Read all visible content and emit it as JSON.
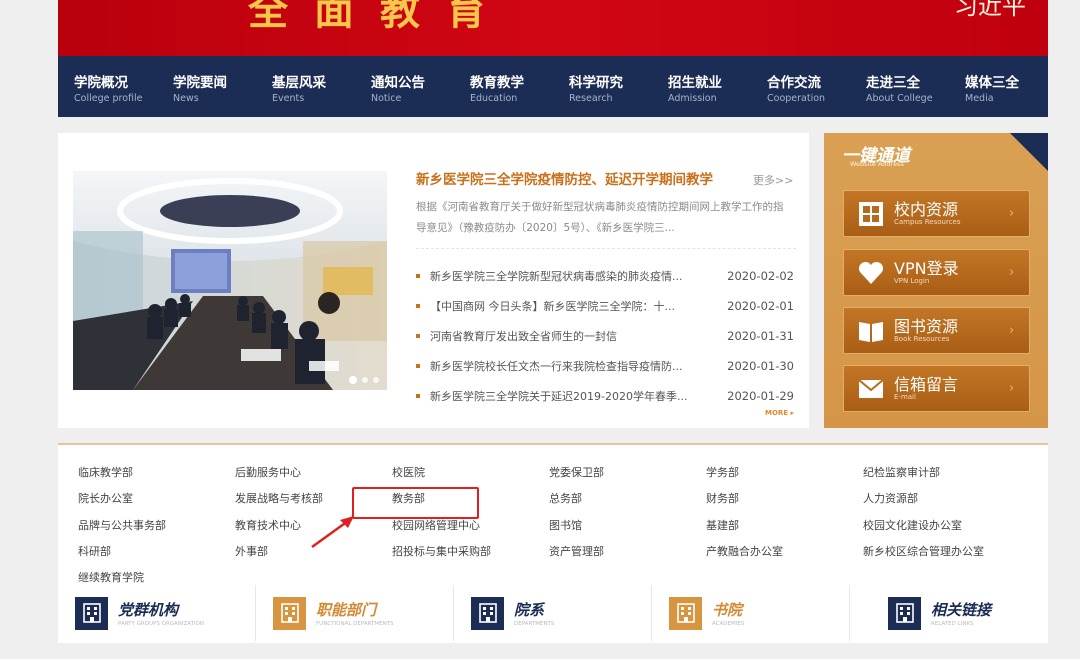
{
  "banner": {
    "title": "全面教育",
    "signature": "习近平"
  },
  "nav": [
    {
      "cn": "学院概况",
      "en": "College profile"
    },
    {
      "cn": "学院要闻",
      "en": "News"
    },
    {
      "cn": "基层风采",
      "en": "Events"
    },
    {
      "cn": "通知公告",
      "en": "Notice"
    },
    {
      "cn": "教育教学",
      "en": "Education"
    },
    {
      "cn": "科学研究",
      "en": "Research"
    },
    {
      "cn": "招生就业",
      "en": "Admission"
    },
    {
      "cn": "合作交流",
      "en": "Cooperation"
    },
    {
      "cn": "走进三全",
      "en": "About College"
    },
    {
      "cn": "媒体三全",
      "en": "Media"
    }
  ],
  "news": {
    "featured_title": "新乡医学院三全学院疫情防控、延迟开学期间教学",
    "more_label": "更多>>",
    "featured_summary": "根据《河南省教育厅关于做好新型冠状病毒肺炎疫情防控期间网上教学工作的指导意见》（豫教疫防办〔2020〕5号）、《新乡医学院三...",
    "items": [
      {
        "title": "新乡医学院三全学院新型冠状病毒感染的肺炎疫情...",
        "date": "2020-02-02"
      },
      {
        "title": "【中国商网 今日头条】新乡医学院三全学院：十...",
        "date": "2020-02-01"
      },
      {
        "title": "河南省教育厅发出致全省师生的一封信",
        "date": "2020-01-31"
      },
      {
        "title": "新乡医学院校长任文杰一行来我院检查指导疫情防...",
        "date": "2020-01-30"
      },
      {
        "title": "新乡医学院三全学院关于延迟2019-2020学年春季...",
        "date": "2020-01-29"
      }
    ],
    "more_small": "MORE ▸"
  },
  "quick": {
    "title": "一键通道",
    "subtitle": "Website Address",
    "buttons": [
      {
        "cn": "校内资源",
        "en": "Campus Resources",
        "icon": "grid-icon"
      },
      {
        "cn": "VPN登录",
        "en": "VPN Login",
        "icon": "heart-icon"
      },
      {
        "cn": "图书资源",
        "en": "Book Resources",
        "icon": "book-icon"
      },
      {
        "cn": "信箱留言",
        "en": "E-mail",
        "icon": "mail-icon"
      }
    ],
    "arrow": "›"
  },
  "departments": [
    "临床教学部",
    "后勤服务中心",
    "校医院",
    "党委保卫部",
    "学务部",
    "纪检监察审计部",
    "院长办公室",
    "发展战略与考核部",
    "教务部",
    "总务部",
    "财务部",
    "人力资源部",
    "品牌与公共事务部",
    "教育技术中心",
    "校园网络管理中心",
    "图书馆",
    "基建部",
    "校园文化建设办公室",
    "科研部",
    "外事部",
    "招投标与集中采购部",
    "资产管理部",
    "产教融合办公室",
    "新乡校区综合管理办公室",
    "继续教育学院"
  ],
  "bottom": [
    {
      "label": "党群机构",
      "en": "PARTY GROUPS ORGANIZATION",
      "theme": "navy"
    },
    {
      "label": "职能部门",
      "en": "FUNCTIONAL DEPARTMENTS",
      "theme": "orange"
    },
    {
      "label": "院系",
      "en": "DEPARTMENTS",
      "theme": "navy"
    },
    {
      "label": "书院",
      "en": "ACADEMIES",
      "theme": "orange"
    },
    {
      "label": "相关链接",
      "en": "RELATED LINKS",
      "theme": "navy"
    }
  ],
  "colors": {
    "navy": "#1b2c55",
    "red": "#c8050f",
    "orange": "#d8953f",
    "highlight": "#e02020"
  }
}
